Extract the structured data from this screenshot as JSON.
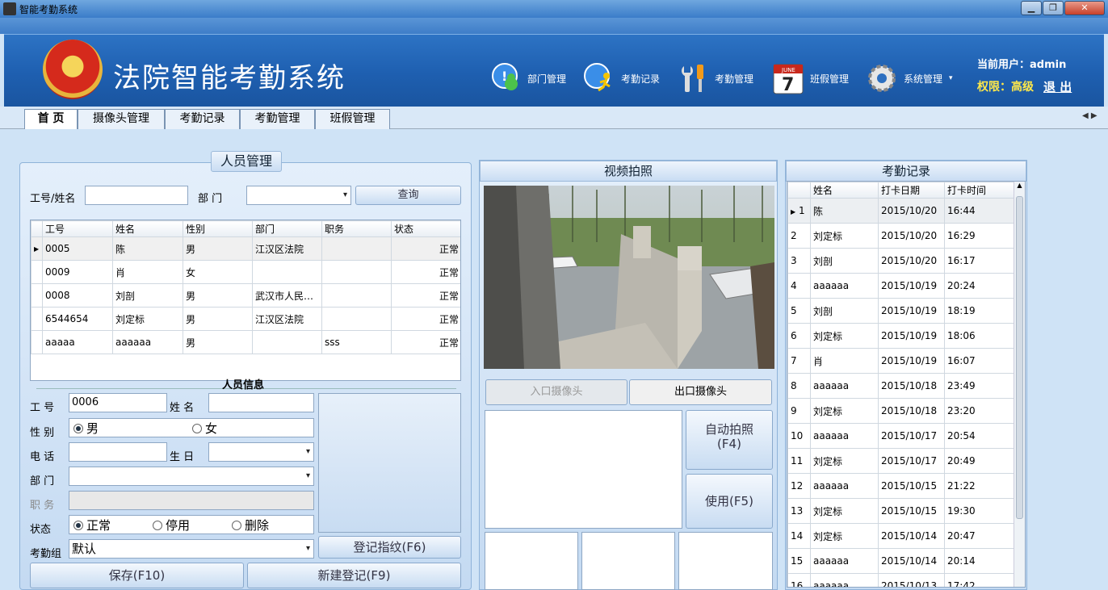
{
  "window": {
    "title": "智能考勤系统",
    "min_glyph": "▁",
    "max_glyph": "❐",
    "close_glyph": "✕"
  },
  "header": {
    "app_title": "法院智能考勤系统",
    "nav": [
      {
        "label": "部门管理",
        "icon": "people-chat-icon"
      },
      {
        "label": "考勤记录",
        "icon": "running-man-icon"
      },
      {
        "label": "考勤管理",
        "icon": "tools-icon"
      },
      {
        "label": "班假管理",
        "icon": "calendar-icon",
        "calendar_month": "JUNE",
        "calendar_day": "7"
      },
      {
        "label": "系统管理",
        "icon": "gear-icon"
      }
    ],
    "current_user_label": "当前用户：admin",
    "permission_label": "权限：高级",
    "logout_label": "退 出"
  },
  "tabs": [
    "首 页",
    "摄像头管理",
    "考勤记录",
    "考勤管理",
    "班假管理"
  ],
  "personnel": {
    "title": "人员管理",
    "search_label": "工号/姓名",
    "dept_label": "部  门",
    "query_button": "查询",
    "columns": [
      "工号",
      "姓名",
      "性别",
      "部门",
      "职务",
      "状态"
    ],
    "rows": [
      {
        "id": "0005",
        "name": "陈",
        "gender": "男",
        "dept": " 江汉区法院",
        "title": "",
        "status": "正常"
      },
      {
        "id": "0009",
        "name": "肖",
        "gender": "女",
        "dept": "",
        "title": "",
        "status": "正常"
      },
      {
        "id": "0008",
        "name": "刘剖",
        "gender": "男",
        "dept": "武汉市人民…",
        "title": "",
        "status": "正常"
      },
      {
        "id": "6544654",
        "name": "刘定标",
        "gender": "男",
        "dept": " 江汉区法院",
        "title": "",
        "status": "正常"
      },
      {
        "id": "aaaaa",
        "name": "aaaaaa",
        "gender": "男",
        "dept": "",
        "title": "sss",
        "status": "正常"
      }
    ]
  },
  "person_info": {
    "title": "人员信息",
    "id_label": "工  号",
    "id_value": "0006",
    "name_label": "姓  名",
    "gender_label": "性  别",
    "male": "男",
    "female": "女",
    "phone_label": "电  话",
    "birthday_label": "生  日",
    "dept_label": "部  门",
    "job_label": "职  务",
    "status_label": "状态",
    "status_normal": "正常",
    "status_disabled": "停用",
    "status_deleted": "删除",
    "group_label": "考勤组",
    "group_value": "默认",
    "fingerprint_button": "登记指纹(F6)",
    "save_button": "保存(F10)",
    "new_button": "新建登记(F9)"
  },
  "video": {
    "title": "视频拍照",
    "entry_camera": "入口摄像头",
    "exit_camera": "出口摄像头",
    "auto_photo_button": "自动拍照\n(F4)",
    "use_button": "使用(F5)"
  },
  "attendance": {
    "title": "考勤记录",
    "columns": [
      "",
      "姓名",
      "打卡日期",
      "打卡时间"
    ],
    "rows": [
      [
        "1",
        "陈",
        "2015/10/20",
        "16:44"
      ],
      [
        "2",
        "刘定标",
        "2015/10/20",
        "16:29"
      ],
      [
        "3",
        "刘剖",
        "2015/10/20",
        "16:17"
      ],
      [
        "4",
        "aaaaaa",
        "2015/10/19",
        "20:24"
      ],
      [
        "5",
        "刘剖",
        "2015/10/19",
        "18:19"
      ],
      [
        "6",
        "刘定标",
        "2015/10/19",
        "18:06"
      ],
      [
        "7",
        "肖",
        "2015/10/19",
        "16:07"
      ],
      [
        "8",
        "aaaaaa",
        "2015/10/18",
        "23:49"
      ],
      [
        "9",
        "刘定标",
        "2015/10/18",
        "23:20"
      ],
      [
        "10",
        "aaaaaa",
        "2015/10/17",
        "20:54"
      ],
      [
        "11",
        "刘定标",
        "2015/10/17",
        "20:49"
      ],
      [
        "12",
        "aaaaaa",
        "2015/10/15",
        "21:22"
      ],
      [
        "13",
        "刘定标",
        "2015/10/15",
        "19:30"
      ],
      [
        "14",
        "刘定标",
        "2015/10/14",
        "20:47"
      ],
      [
        "15",
        "aaaaaa",
        "2015/10/14",
        "20:14"
      ],
      [
        "16",
        "aaaaaa",
        "2015/10/13",
        "17:42"
      ]
    ]
  },
  "colors": {
    "header_blue": "#1e5fb0",
    "permission_yellow": "#ffe84a"
  }
}
